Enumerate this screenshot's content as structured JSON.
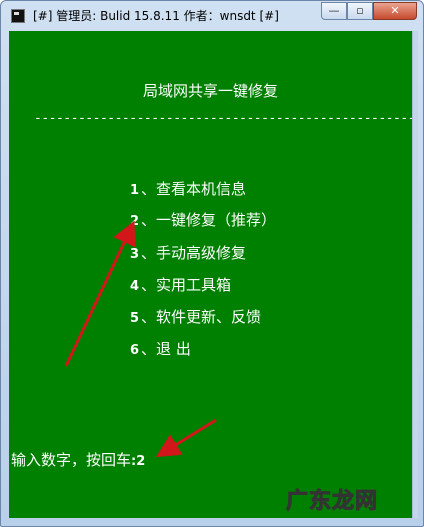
{
  "window": {
    "title": "[#] 管理员:  Bulid 15.8.11   作者：wnsdt [#]",
    "controls": {
      "minimize": "—",
      "maximize": "▫",
      "close": "✕"
    }
  },
  "console": {
    "heading": "局域网共享一键修复",
    "divider": "-----------------------------------------------------",
    "menu": [
      {
        "num": "1",
        "label": "、查看本机信息"
      },
      {
        "num": "2",
        "label": "、一键修复（推荐）"
      },
      {
        "num": "3",
        "label": "、手动高级修复"
      },
      {
        "num": "4",
        "label": "、实用工具箱"
      },
      {
        "num": "5",
        "label": "、软件更新、反馈"
      },
      {
        "num": "6",
        "label": "、退   出"
      }
    ],
    "prompt_label": "输入数字，按回车",
    "prompt_input": ":2"
  },
  "watermark": "广东龙网",
  "colors": {
    "console_bg": "#008000",
    "console_text": "#ffffff",
    "arrow": "#d2171b"
  }
}
